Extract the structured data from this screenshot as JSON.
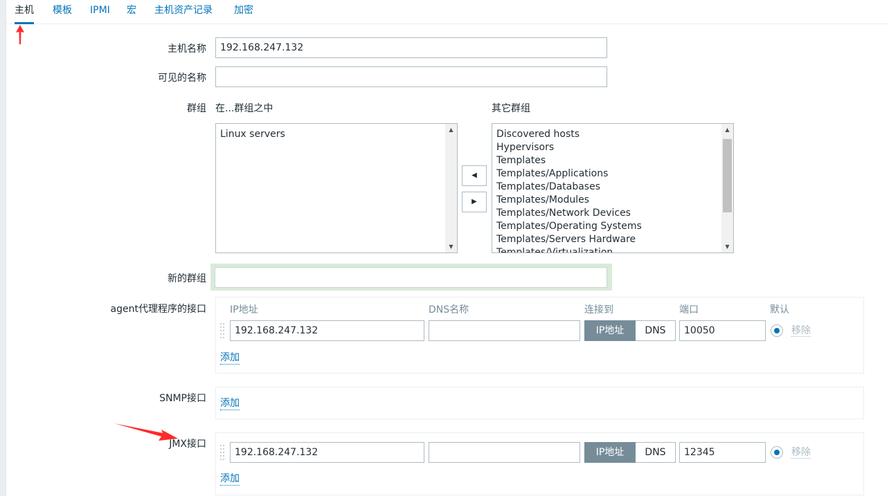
{
  "tabs": [
    "主机",
    "模板",
    "IPMI",
    "宏",
    "主机资产记录",
    "加密"
  ],
  "form": {
    "host_name_label": "主机名称",
    "host_name_value": "192.168.247.132",
    "visible_name_label": "可见的名称",
    "visible_name_value": "",
    "groups_label": "群组",
    "in_groups_label": "在...群组之中",
    "other_groups_label": "其它群组",
    "in_groups": [
      "Linux servers"
    ],
    "other_groups": [
      "Discovered hosts",
      "Hypervisors",
      "Templates",
      "Templates/Applications",
      "Templates/Databases",
      "Templates/Modules",
      "Templates/Network Devices",
      "Templates/Operating Systems",
      "Templates/Servers Hardware",
      "Templates/Virtualization"
    ],
    "move_left_symbol": "◀",
    "move_right_symbol": "▶",
    "new_group_label": "新的群组",
    "new_group_value": ""
  },
  "interfaces": {
    "columns": {
      "ip": "IP地址",
      "dns": "DNS名称",
      "connect_to": "连接到",
      "port": "端口",
      "default": "默认"
    },
    "connect_ip_label": "IP地址",
    "connect_dns_label": "DNS",
    "remove_label": "移除",
    "add_label": "添加",
    "agent": {
      "label": "agent代理程序的接口",
      "ip": "192.168.247.132",
      "dns": "",
      "port": "10050",
      "connect_to": "IP地址",
      "default": true
    },
    "snmp": {
      "label": "SNMP接口"
    },
    "jmx": {
      "label": "JMX接口",
      "ip": "192.168.247.132",
      "dns": "",
      "port": "12345",
      "connect_to": "IP地址",
      "default": true
    }
  },
  "colors": {
    "link": "#0275b8",
    "annotation_arrow": "#ff2a2a",
    "segment_active": "#768d99"
  }
}
